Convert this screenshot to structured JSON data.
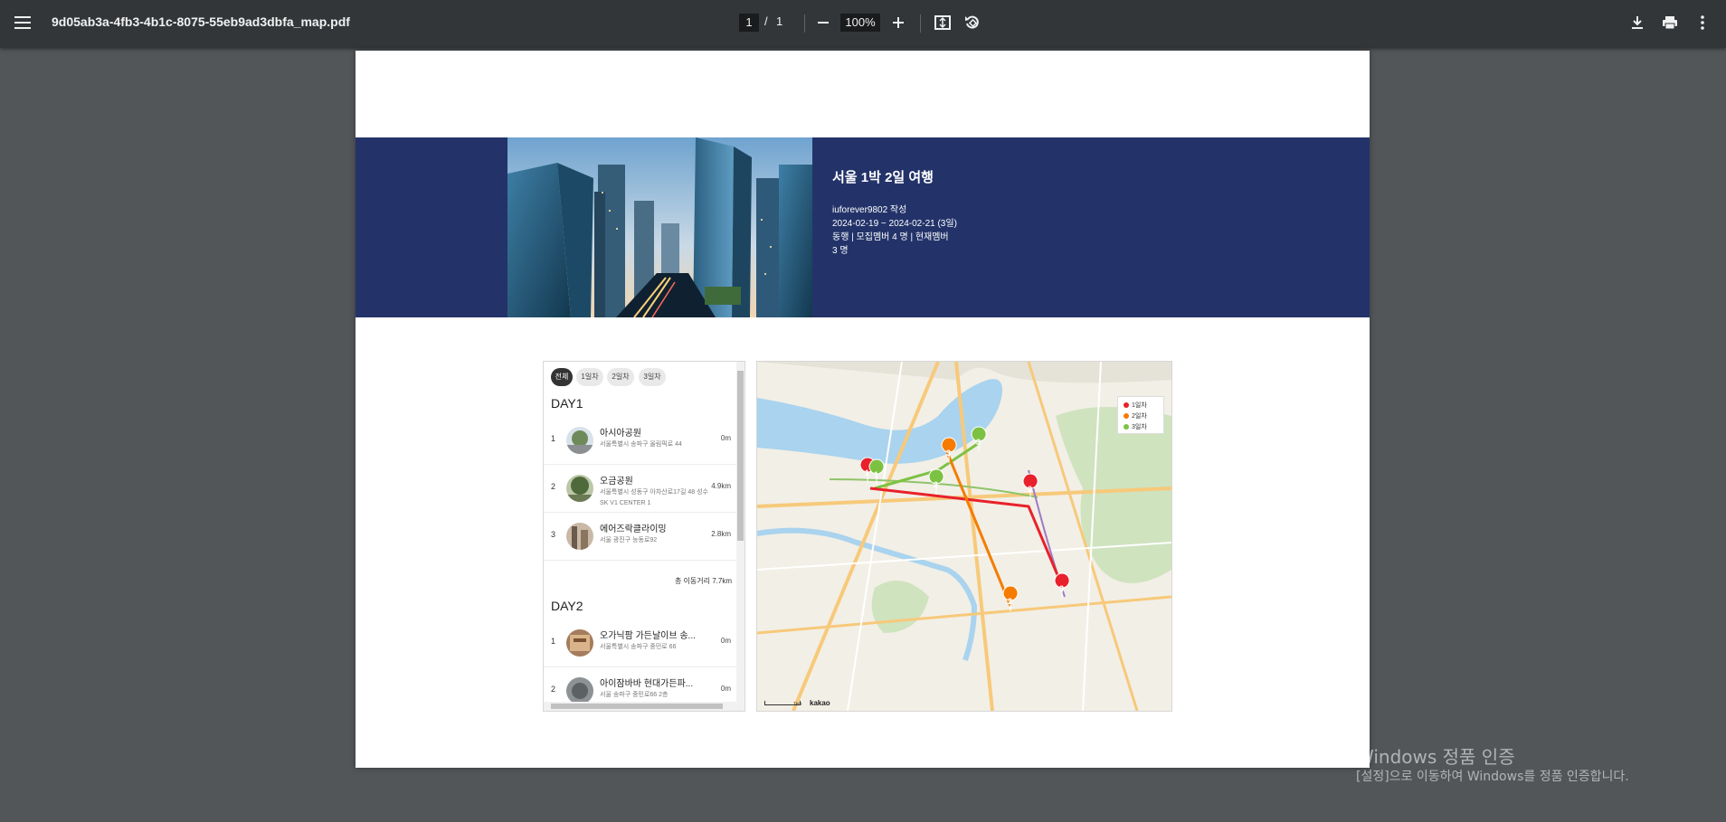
{
  "toolbar": {
    "filename": "9d05ab3a-4fb3-4b1c-8075-55eb9ad3dbfa_map.pdf",
    "page_current": "1",
    "page_sep": "/",
    "page_total": "1",
    "zoom": "100%"
  },
  "banner": {
    "title": "서울 1박 2일 여행",
    "author": "iuforever9802 작성",
    "dates": "2024-02-19 ~ 2024-02-21 (3일)",
    "members": "동행 | 모집멤버 4 명 | 현재멤버",
    "count": "3 명"
  },
  "itinerary": {
    "tabs": [
      "전체",
      "1일차",
      "2일차",
      "3일차"
    ],
    "active_tab_index": 0,
    "days": [
      {
        "label": "DAY1",
        "items": [
          {
            "num": "1",
            "name": "아시아공원",
            "address": "서울특별시 송파구 올림픽로 44",
            "distance": "0m"
          },
          {
            "num": "2",
            "name": "오금공원",
            "address": "서울특별시 성동구 아차산로17길 48 성수 SK V1 CENTER 1",
            "distance": "4.9km"
          },
          {
            "num": "3",
            "name": "에어즈락클라이밍",
            "address": "서울 광진구 능동로92",
            "distance": "2.8km"
          }
        ],
        "total": "총 이동거리 7.7km"
      },
      {
        "label": "DAY2",
        "items": [
          {
            "num": "1",
            "name": "오가닉팜 가든날이브 송...",
            "address": "서울특별시 송파구 중민로 66",
            "distance": "0m"
          },
          {
            "num": "2",
            "name": "아이잠바바 현대가든파...",
            "address": "서울 송파구 중민로66 2층",
            "distance": "0m"
          }
        ]
      }
    ]
  },
  "map": {
    "legend": [
      {
        "label": "1일차",
        "color": "#e8212b"
      },
      {
        "label": "2일차",
        "color": "#f57c00"
      },
      {
        "label": "3일차",
        "color": "#7cc242"
      }
    ],
    "brand": "kakao",
    "scale": "1km"
  },
  "watermark": {
    "line1": "Windows 정품 인증",
    "line2": "[설정]으로 이동하여 Windows를 정품 인증합니다."
  }
}
